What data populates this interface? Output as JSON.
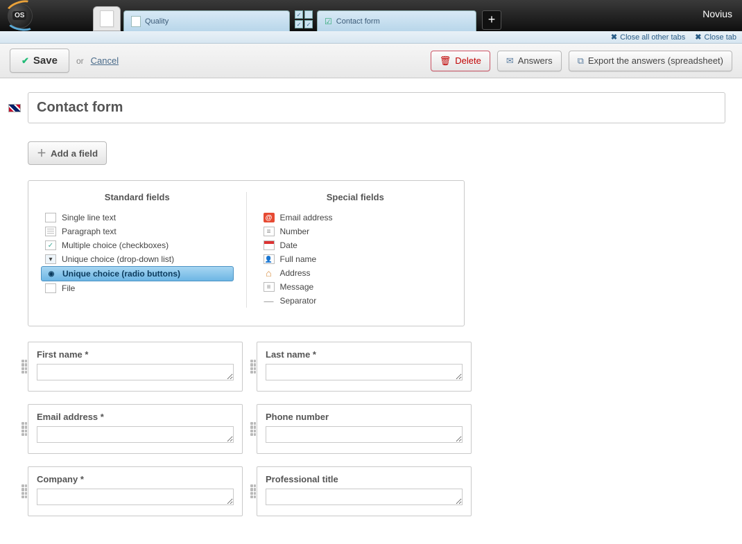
{
  "brand": "Novius",
  "tabs": {
    "quality": "Quality",
    "contact": "Contact form"
  },
  "closebar": {
    "close_all": "Close all other tabs",
    "close_tab": "Close tab"
  },
  "actions": {
    "save": "Save",
    "or": "or",
    "cancel": "Cancel",
    "delete": "Delete",
    "answers": "Answers",
    "export": "Export the answers (spreadsheet)"
  },
  "title": "Contact form",
  "add_field": "Add a field",
  "palette": {
    "standard_heading": "Standard fields",
    "special_heading": "Special fields",
    "standard": {
      "single_line": "Single line text",
      "paragraph": "Paragraph text",
      "multiple": "Multiple choice (checkboxes)",
      "dropdown": "Unique choice (drop-down list)",
      "radio": "Unique choice (radio buttons)",
      "file": "File"
    },
    "special": {
      "email": "Email address",
      "number": "Number",
      "date": "Date",
      "fullname": "Full name",
      "address": "Address",
      "message": "Message",
      "separator": "Separator"
    }
  },
  "form_fields": {
    "first_name": "First name *",
    "last_name": "Last name *",
    "email": "Email address *",
    "phone": "Phone number",
    "company": "Company *",
    "pro_title": "Professional title"
  }
}
